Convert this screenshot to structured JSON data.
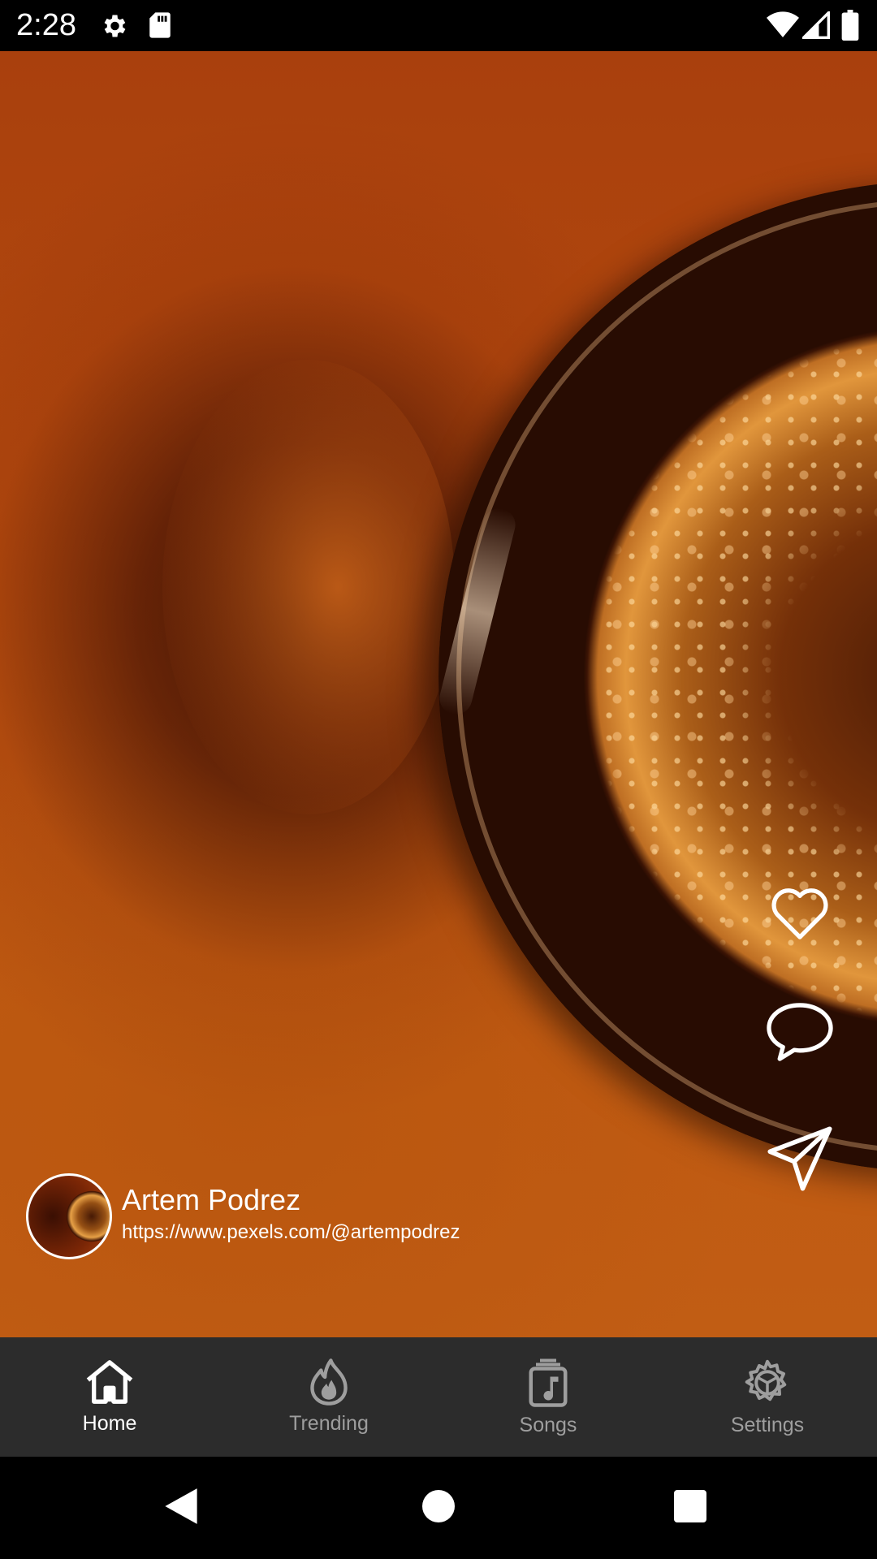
{
  "status_bar": {
    "time": "2:28",
    "icons": [
      "settings-gear-icon",
      "sd-card-icon",
      "wifi-icon",
      "cellular-signal-icon",
      "battery-icon"
    ]
  },
  "video": {
    "author_name": "Artem Podrez",
    "author_url": "https://www.pexels.com/@artempodrez",
    "actions": [
      "heart-icon",
      "comment-icon",
      "share-send-icon"
    ]
  },
  "bottom_nav": {
    "items": [
      {
        "label": "Home",
        "icon": "home-icon",
        "active": true
      },
      {
        "label": "Trending",
        "icon": "flame-icon",
        "active": false
      },
      {
        "label": "Songs",
        "icon": "music-note-icon",
        "active": false
      },
      {
        "label": "Settings",
        "icon": "settings-icon",
        "active": false
      }
    ]
  },
  "system_nav": {
    "buttons": [
      "back-triangle-icon",
      "home-circle-icon",
      "recents-square-icon"
    ]
  },
  "colors": {
    "nav_background": "#2c2c2c",
    "nav_active": "#ffffff",
    "nav_inactive": "#9e9e9e",
    "video_tone": "#b44a0e"
  }
}
